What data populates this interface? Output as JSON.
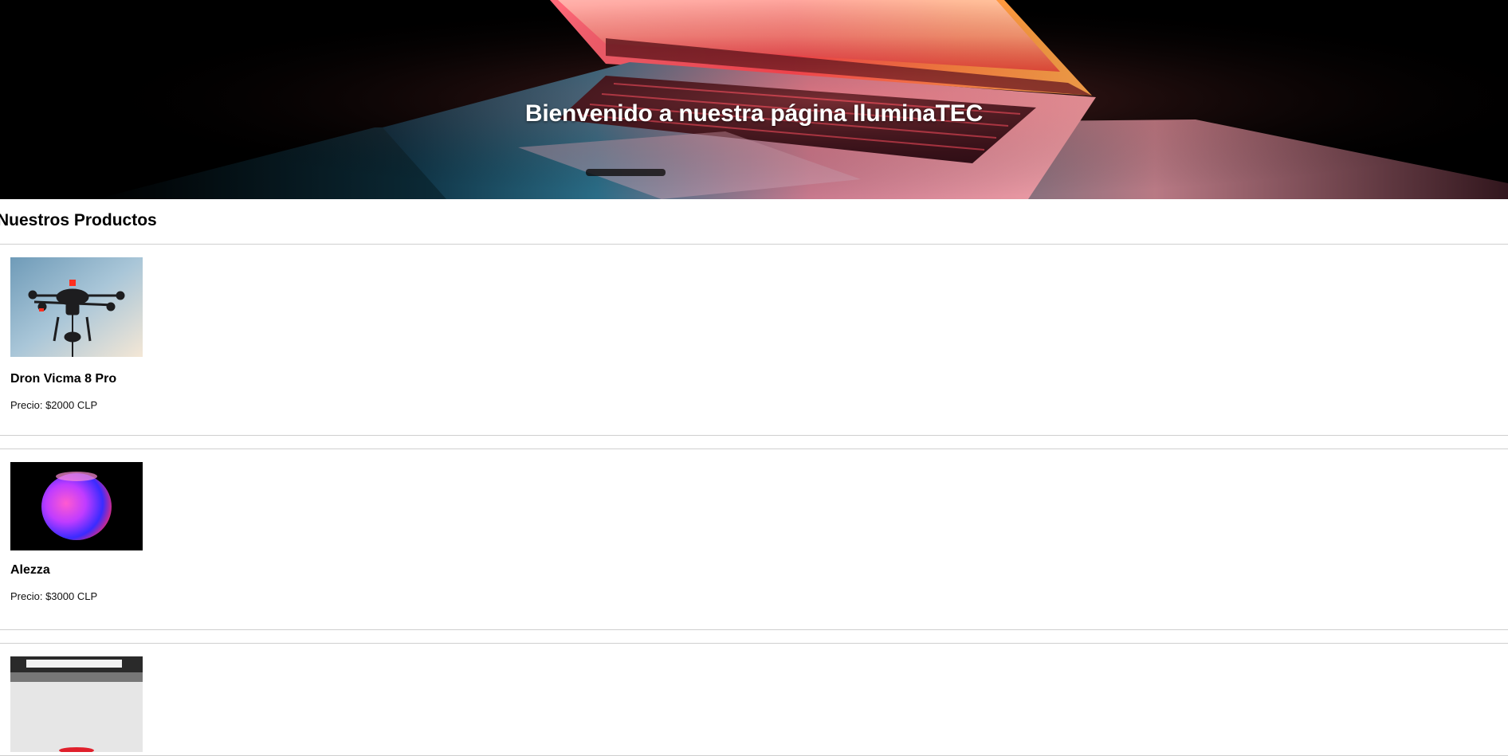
{
  "hero": {
    "title": "Bienvenido a nuestra página IluminaTEC"
  },
  "products_section": {
    "title": "Nuestros Productos",
    "items": [
      {
        "name": "Dron Vicma 8 Pro",
        "price": "Precio: $2000 CLP",
        "image": "drone-photo"
      },
      {
        "name": "Alezza",
        "price": "Precio: $3000 CLP",
        "image": "smart-speaker-photo"
      },
      {
        "name": "",
        "price": "",
        "image": "product-photo-partial"
      }
    ]
  },
  "colors": {
    "hero_bg": "#000000",
    "text": "#000000",
    "divider": "#cfcfcf",
    "hero_text": "#ffffff"
  }
}
